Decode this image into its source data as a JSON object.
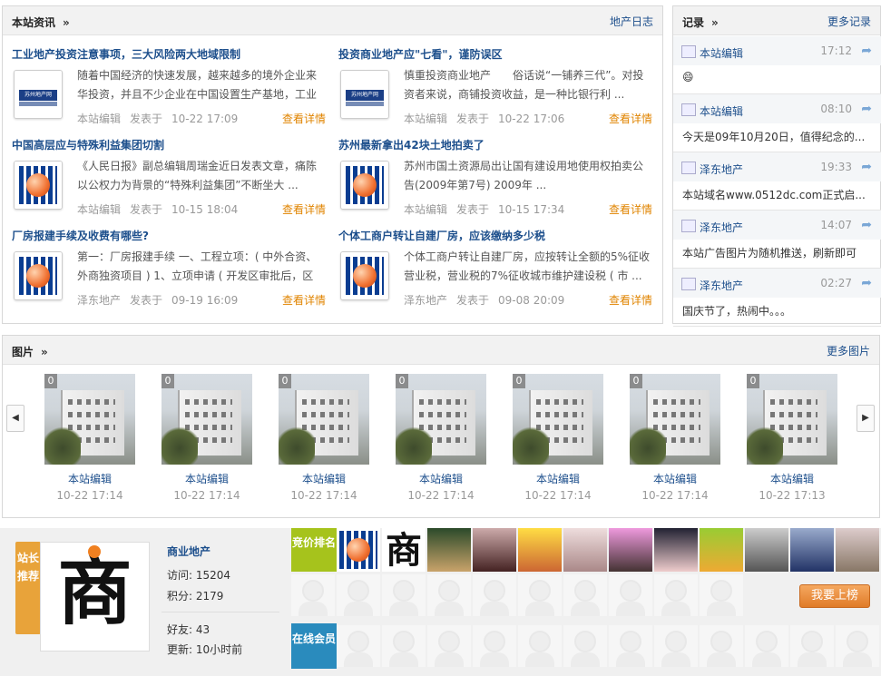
{
  "news_panel": {
    "title": "本站资讯",
    "more": "地产日志"
  },
  "news": [
    {
      "title": "工业地产投资注意事项，三大风险两大地域限制",
      "logo": "苏州地产网",
      "summary": "随着中国经济的快速发展，越来越多的境外企业来华投资，并且不少企业在中国设置生产基地，工业",
      "author": "本站编辑",
      "posted": "发表于",
      "date": "10-22 17:09",
      "detail": "查看详情"
    },
    {
      "title": "投资商业地产应\"七看\"，谨防误区",
      "logo": "苏州地产网",
      "summary": "慎重投资商业地产　　俗话说“一铺养三代”。对投资者来说，商铺投资收益，是一种比银行利 ...",
      "author": "本站编辑",
      "posted": "发表于",
      "date": "10-22 17:06",
      "detail": "查看详情"
    },
    {
      "title": "中国高层应与特殊利益集团切割",
      "logo": "",
      "summary": "《人民日报》副总编辑周瑞金近日发表文章，痛陈以公权力为背景的“特殊利益集团”不断坐大 ...",
      "author": "本站编辑",
      "posted": "发表于",
      "date": "10-15 18:04",
      "detail": "查看详情"
    },
    {
      "title": "苏州最新拿出42块土地拍卖了",
      "logo": "",
      "summary": "苏州市国土资源局出让国有建设用地使用权拍卖公告(2009年第7号) 2009年 ...",
      "author": "本站编辑",
      "posted": "发表于",
      "date": "10-15 17:34",
      "detail": "查看详情"
    },
    {
      "title": "厂房报建手续及收费有哪些?",
      "logo": "",
      "summary": "第一：厂房报建手续 一、工程立项：( 中外合资、外商独资项目 ) 1、立项申请 ( 开发区审批后，区",
      "author": "泽东地产",
      "posted": "发表于",
      "date": "09-19 16:09",
      "detail": "查看详情"
    },
    {
      "title": "个体工商户转让自建厂房，应该缴纳多少税",
      "logo": "",
      "summary": "个体工商户转让自建厂房，应按转让全额的5%征收营业税，营业税的7%征收城市维护建设税 ( 市 ...",
      "author": "泽东地产",
      "posted": "发表于",
      "date": "09-08 20:09",
      "detail": "查看详情"
    }
  ],
  "record_panel": {
    "title": "记录",
    "more": "更多记录"
  },
  "records": [
    {
      "user": "本站编辑",
      "time": "17:12",
      "body": "😄"
    },
    {
      "user": "本站编辑",
      "time": "08:10",
      "body": "今天是09年10月20日，值得纪念的..."
    },
    {
      "user": "泽东地产",
      "time": "19:33",
      "body": "本站域名www.0512dc.com正式启..."
    },
    {
      "user": "泽东地产",
      "time": "14:07",
      "body": "本站广告图片为随机推送，刷新即可"
    },
    {
      "user": "泽东地产",
      "time": "02:27",
      "body": "国庆节了，热闹中。。。"
    }
  ],
  "pics_panel": {
    "title": "图片",
    "more": "更多图片"
  },
  "pics": [
    {
      "count": "0",
      "user": "本站编辑",
      "date": "10-22 17:14"
    },
    {
      "count": "0",
      "user": "本站编辑",
      "date": "10-22 17:14"
    },
    {
      "count": "0",
      "user": "本站编辑",
      "date": "10-22 17:14"
    },
    {
      "count": "0",
      "user": "本站编辑",
      "date": "10-22 17:14"
    },
    {
      "count": "0",
      "user": "本站编辑",
      "date": "10-22 17:14"
    },
    {
      "count": "0",
      "user": "本站编辑",
      "date": "10-22 17:14"
    },
    {
      "count": "0",
      "user": "本站编辑",
      "date": "10-22 17:13"
    }
  ],
  "nav": {
    "prev": "◀",
    "next": "▶"
  },
  "recommend": {
    "tag": "站长推荐",
    "avatar_char": "商",
    "name": "商业地产",
    "visits_label": "访问: ",
    "visits": "15204",
    "points_label": "积分: ",
    "points": "2179",
    "friends_label": "好友: ",
    "friends": "43",
    "update_label": "更新: ",
    "update": "10小时前"
  },
  "ranking": {
    "tag": "竞价排名",
    "char": "商",
    "button": "我要上榜"
  },
  "online": {
    "tag": "在线会员"
  },
  "colors": {
    "link": "#1d4f8c",
    "accent": "#e08400",
    "tag_green": "#a6c31c",
    "tag_blue": "#2a8bbd",
    "tag_orange": "#e8a33a"
  }
}
